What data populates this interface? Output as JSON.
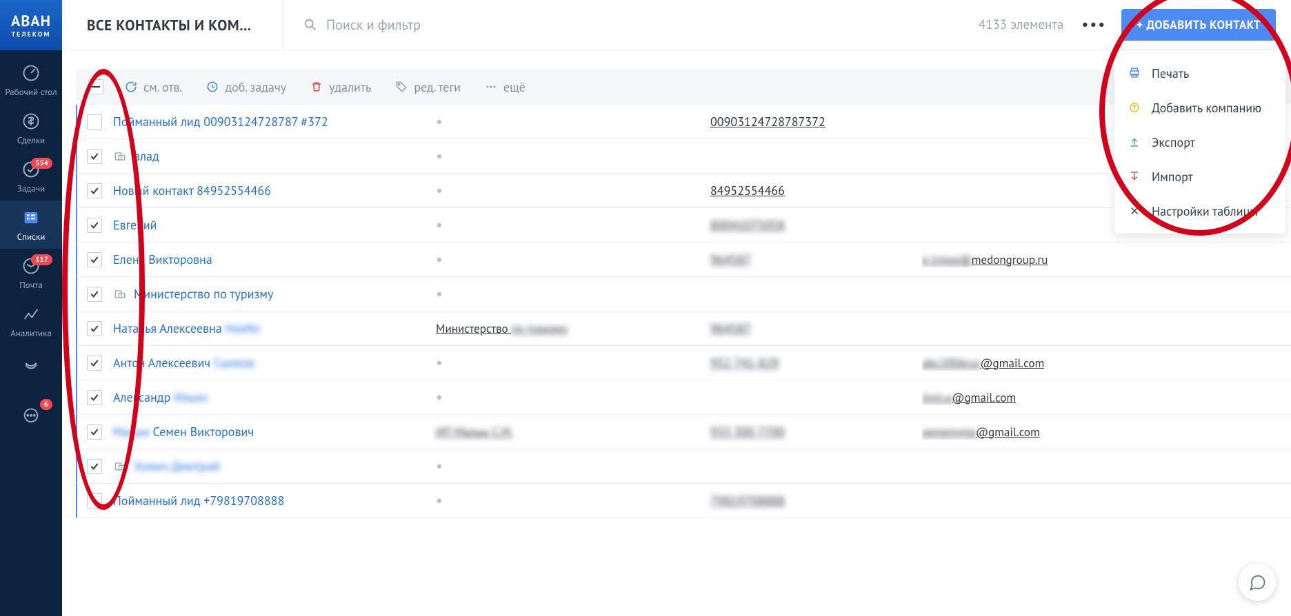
{
  "logo": {
    "line1": "АВАН",
    "line2": "ТЕЛЕКОМ"
  },
  "sidebar": [
    {
      "label": "Рабочий стол",
      "badge": ""
    },
    {
      "label": "Сделки",
      "badge": ""
    },
    {
      "label": "Задачи",
      "badge": "554"
    },
    {
      "label": "Списки",
      "badge": "",
      "active": true
    },
    {
      "label": "Почта",
      "badge": "117"
    },
    {
      "label": "Аналитика",
      "badge": ""
    },
    {
      "label": "",
      "badge": ""
    },
    {
      "label": "",
      "badge": "6"
    }
  ],
  "header": {
    "title": "ВСЕ КОНТАКТЫ И КОМ…",
    "search_placeholder": "Поиск и фильтр",
    "count": "4133 элемента",
    "add_button": "+ ДОБАВИТЬ КОНТАКТ"
  },
  "actions": {
    "sm_otv": "см. отв.",
    "add_task": "доб. задачу",
    "delete": "удалить",
    "edit_tags": "ред. теги",
    "more": "ещё"
  },
  "dropdown": {
    "print": "Печать",
    "add_company": "Добавить компанию",
    "export": "Экспорт",
    "import": "Импорт",
    "table_settings": "Настройки таблицы"
  },
  "rows": [
    {
      "checked": false,
      "company_icon": false,
      "name": "Пойманный лид 00903124728787 #372",
      "company": "",
      "phone": "00903124728787372",
      "email": ""
    },
    {
      "checked": true,
      "company_icon": true,
      "name": "влад",
      "company": "",
      "phone": "",
      "email": ""
    },
    {
      "checked": true,
      "company_icon": false,
      "name": "Новый контакт 84952554466",
      "company": "",
      "phone": "84952554466",
      "email": ""
    },
    {
      "checked": true,
      "company_icon": false,
      "name": "Евгений",
      "company": "",
      "phone_blur": "80041075058",
      "email": ""
    },
    {
      "checked": true,
      "company_icon": false,
      "name": "Елена Викторовна",
      "company": "",
      "phone_blur": "964587",
      "email_blur": "e.1moo@",
      "email": "medongroup.ru"
    },
    {
      "checked": true,
      "company_icon": true,
      "name": "Министерство по туризму",
      "company": "",
      "phone": "",
      "email": ""
    },
    {
      "checked": true,
      "company_icon": false,
      "name": "Наталья Алексеевна",
      "name_blur": "Hoefer",
      "company": "Министерство",
      "company_blur": "по туризму",
      "phone_blur": "964587",
      "email": ""
    },
    {
      "checked": true,
      "company_icon": false,
      "name_blur": "Сынков",
      "name": "Антон Алексеевич",
      "company": "",
      "phone_blur": "952 741-829",
      "email_blur": "abc2006rus",
      "email": "@gmail.com"
    },
    {
      "checked": true,
      "company_icon": false,
      "name": "Александр",
      "name_blur": "Ильин",
      "company": "",
      "phone": "",
      "email_blur": "ilyin.a",
      "email": "@gmail.com"
    },
    {
      "checked": true,
      "company_icon": false,
      "name_blur_pre": "Малык",
      "name": "Семен Викторович",
      "company_blur": "ИП Малык С.М.",
      "phone_blur": "933 300 7700",
      "email_blur": "semenvma",
      "email": "@gmail.com"
    },
    {
      "checked": true,
      "company_icon": true,
      "name_blur": "Хомич Дмитрий",
      "company": "",
      "phone": "",
      "email": ""
    },
    {
      "checked": false,
      "company_icon": false,
      "name": "Пойманный лид +79819708888",
      "company": "",
      "phone_blur": "79819708888",
      "email": ""
    }
  ]
}
